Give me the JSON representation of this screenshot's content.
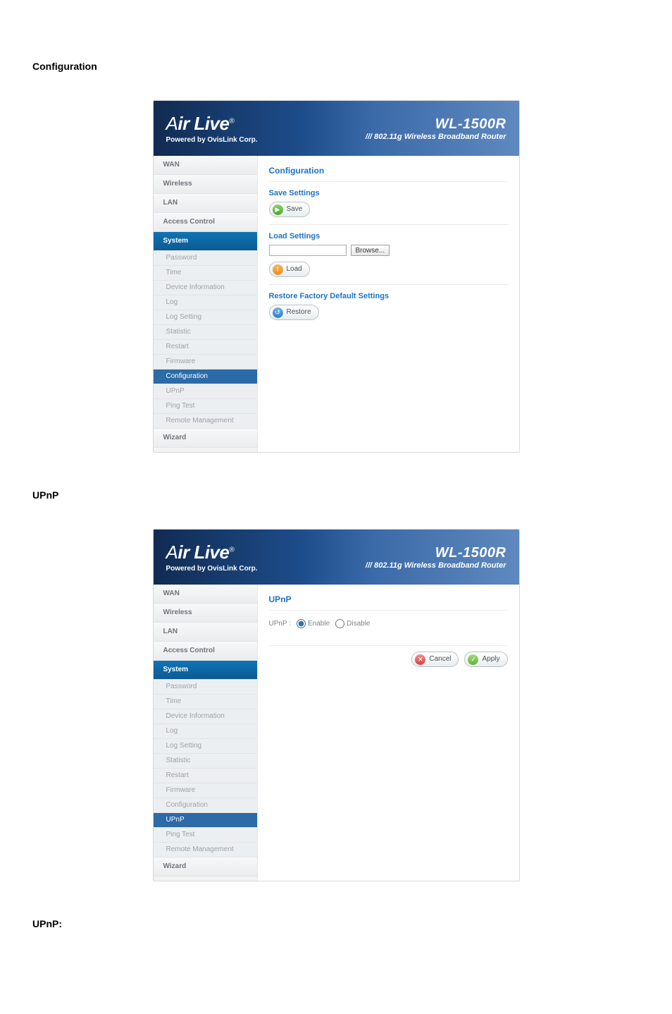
{
  "doc": {
    "h_configuration": "Configuration",
    "h_upnp": "UPnP",
    "h_upnp_colon": "UPnP:"
  },
  "brand": {
    "name_html": "Air Live",
    "sup": "®",
    "sub": "Powered by OvisLink Corp."
  },
  "model": {
    "name": "WL-1500R",
    "sub": "/// 802.11g Wireless Broadband Router"
  },
  "nav": {
    "wan": "WAN",
    "wireless": "Wireless",
    "lan": "LAN",
    "access": "Access Control",
    "system": "System",
    "password": "Password",
    "time": "Time",
    "devinfo": "Device Information",
    "log": "Log",
    "logset": "Log Setting",
    "stat": "Statistic",
    "restart": "Restart",
    "firmware": "Firmware",
    "config": "Configuration",
    "upnp": "UPnP",
    "ping": "Ping Test",
    "remote": "Remote Management",
    "wizard": "Wizard"
  },
  "cfg": {
    "crumb": "Configuration",
    "save_title": "Save Settings",
    "save_btn": "Save",
    "load_title": "Load Settings",
    "browse_btn": "Browse...",
    "load_btn": "Load",
    "restore_title": "Restore Factory Default Settings",
    "restore_btn": "Restore"
  },
  "upnp": {
    "crumb": "UPnP",
    "label": "UPnP :",
    "enable": "Enable",
    "disable": "Disable",
    "cancel": "Cancel",
    "apply": "Apply"
  }
}
